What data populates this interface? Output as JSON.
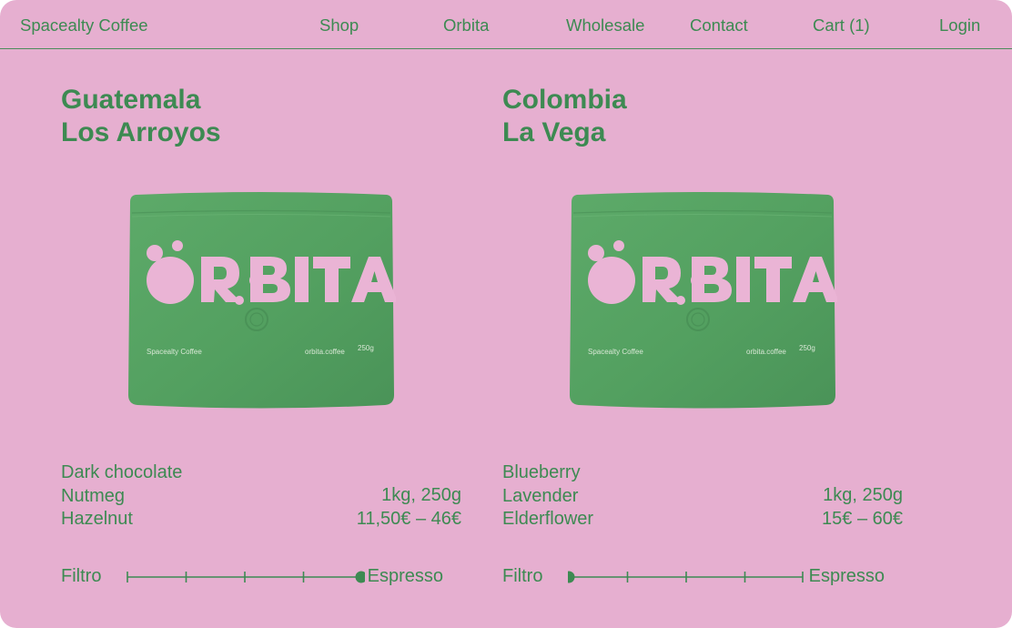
{
  "nav": {
    "brand": "Spacealty Coffee",
    "items": [
      "Shop",
      "Orbita",
      "Wholesale",
      "Contact",
      "Cart (1)",
      "Login"
    ]
  },
  "products": [
    {
      "title_line1": "Guatemala",
      "title_line2": "Los Arroyos",
      "notes": [
        "Dark chocolate",
        "Nutmeg",
        "Hazelnut"
      ],
      "sizes": "1kg, 250g",
      "price": "11,50€ – 46€",
      "roast_left": "Filtro",
      "roast_right": "Espresso",
      "roast_level": 1.0,
      "bag": {
        "logo": "ORBITA",
        "brand": "Spacealty Coffee",
        "site": "orbita.coffee",
        "weight": "250g"
      }
    },
    {
      "title_line1": "Colombia",
      "title_line2": "La Vega",
      "notes": [
        "Blueberry",
        "Lavender",
        "Elderflower"
      ],
      "sizes": "1kg, 250g",
      "price": "15€ – 60€",
      "roast_left": "Filtro",
      "roast_right": "Espresso",
      "roast_level": 0.0,
      "bag": {
        "logo": "ORBITA",
        "brand": "Spacealty Coffee",
        "site": "orbita.coffee",
        "weight": "250g"
      }
    }
  ],
  "colors": {
    "background": "#e6afd0",
    "text_green": "#3d8a52",
    "bag_green": "#56a163",
    "bag_logo_pink": "#eab4d5"
  }
}
